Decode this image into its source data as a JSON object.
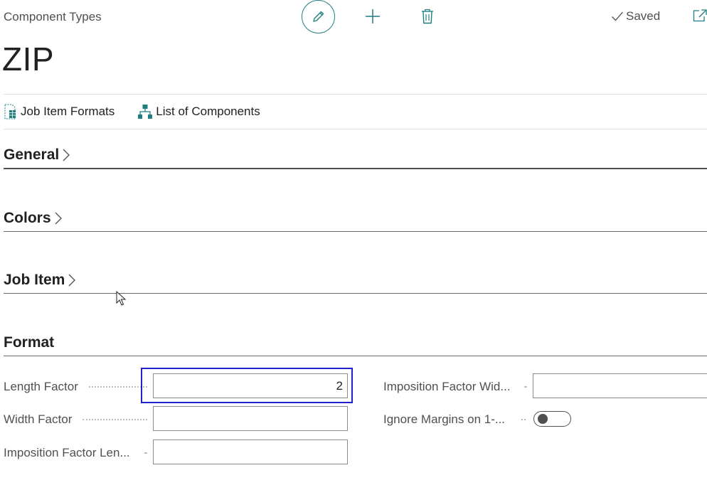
{
  "header": {
    "breadcrumb": "Component Types",
    "saved_label": "Saved",
    "title": "ZIP"
  },
  "toolbar": {
    "edit_icon": "pencil-icon",
    "new_icon": "plus-icon",
    "delete_icon": "trash-icon",
    "accent": "#1f7f80"
  },
  "actions": [
    {
      "label": "Job Item Formats",
      "icon": "document-grid-icon"
    },
    {
      "label": "List of Components",
      "icon": "hierarchy-icon"
    }
  ],
  "sections": {
    "general": "General",
    "colors": "Colors",
    "job_item": "Job Item",
    "format": "Format"
  },
  "format_fields": {
    "length_factor": {
      "label": "Length Factor",
      "value": "2"
    },
    "width_factor": {
      "label": "Width Factor",
      "value": ""
    },
    "imposition_factor_length": {
      "label": "Imposition Factor Len...",
      "value": ""
    },
    "imposition_factor_width": {
      "label": "Imposition Factor Wid...",
      "value": ""
    },
    "ignore_margins": {
      "label": "Ignore Margins on 1-...",
      "value": false
    }
  }
}
